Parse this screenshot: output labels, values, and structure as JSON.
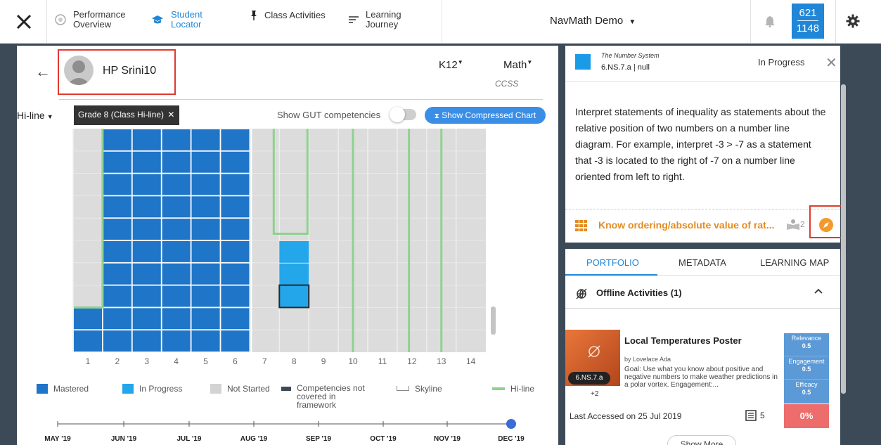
{
  "nav": {
    "items": [
      {
        "label": "Performance Overview"
      },
      {
        "label": "Student Locator"
      },
      {
        "label": "Class Activities"
      },
      {
        "label": "Learning Journey"
      }
    ],
    "title": "NavMath Demo",
    "score_top": "621",
    "score_bottom": "1148"
  },
  "student": {
    "name": "HP Srini10",
    "grade_menu": "K12",
    "subject_menu": "Math",
    "framework": "CCSS"
  },
  "controls": {
    "hiline": "Hi-line",
    "grade_chip": "Grade 8 (Class Hi-line)",
    "gut_label": "Show GUT competencies",
    "compress": "Show Compressed Chart"
  },
  "chart_data": {
    "type": "heatmap",
    "title": "",
    "columns": [
      "1",
      "2",
      "3",
      "4",
      "5",
      "6",
      "7",
      "8",
      "9",
      "10",
      "11",
      "12",
      "13",
      "14"
    ],
    "mastered_columns": [
      "1",
      "2",
      "3",
      "4",
      "5",
      "6"
    ],
    "in_progress_cells": [
      {
        "column": "8",
        "rows_from_bottom": [
          2,
          3,
          4
        ]
      }
    ],
    "legend": [
      "Mastered",
      "In Progress",
      "Not Started",
      "Competencies not covered in framework",
      "Skyline",
      "Hi-line"
    ],
    "colors": {
      "mastered": "#1f75c7",
      "in_progress": "#24a6eb",
      "not_started": "#dcdcdc",
      "hiline": "#8fd18f"
    }
  },
  "legend": {
    "mastered": "Mastered",
    "in_progress": "In Progress",
    "not_started": "Not Started",
    "not_covered_1": "Competencies not",
    "not_covered_2": "covered in",
    "not_covered_3": "framework",
    "skyline": "Skyline",
    "hiline": "Hi-line"
  },
  "timeline": {
    "months": [
      "MAY '19",
      "JUN '19",
      "JUL '19",
      "AUG '19",
      "SEP '19",
      "OCT '19",
      "NOV '19",
      "DEC '19"
    ]
  },
  "competency": {
    "domain": "The Number System",
    "code": "6.NS.7.a | null",
    "status": "In Progress",
    "description": "Interpret statements of inequality as statements about the relative position of two numbers on a number line diagram. For example, interpret -3 > -7 as a statement that -3 is located to the right of -7 on a number line oriented from left to right.",
    "name": "Know ordering/absolute value of rat...",
    "count": "2"
  },
  "tabs": {
    "portfolio": "PORTFOLIO",
    "metadata": "METADATA",
    "learning_map": "LEARNING MAP"
  },
  "offline": {
    "title": "Offline Activities (1)",
    "activity_title": "Local Temperatures Poster",
    "author": "by Lovelace Ada",
    "goal": "Goal: Use what you know about positive and negative numbers to make weather predictions in a polar vortex. Engagement:...",
    "code_chip": "6.NS.7.a",
    "plus": "+2",
    "relevance_label": "Relevance",
    "relevance": "0.5",
    "engagement_label": "Engagement",
    "engagement": "0.5",
    "efficacy_label": "Efficacy",
    "efficacy": "0.5",
    "percent": "0%",
    "last_accessed": "Last Accessed on 25 Jul 2019",
    "notes": "5",
    "show_more": "Show More"
  }
}
